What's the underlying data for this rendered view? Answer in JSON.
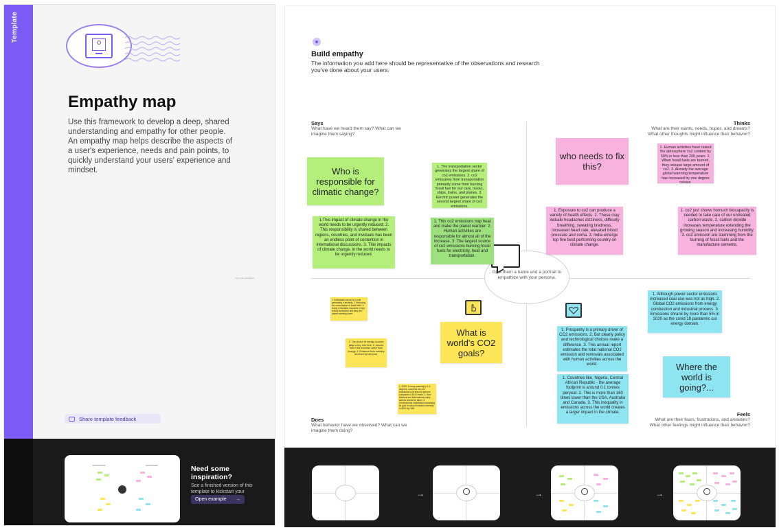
{
  "left_panel": {
    "strip_label": "Template",
    "title": "Empathy map",
    "description": "Use this framework to develop a deep, shared understanding and empathy for other people. An empathy map helps describe the aspects of a user's experience, needs and pain points, to quickly understand your users' experience and mindset.",
    "tiny_note": "Type your paragraph...",
    "feedback_label": "Share template feedback",
    "inspiration": {
      "title": "Need some inspiration?",
      "subtitle": "See a finished version of this template to kickstart your work.",
      "button_label": "Open example",
      "button_arrow": "→"
    }
  },
  "board": {
    "title": "Build empathy",
    "description": "The information you add here should be representative of the observations and research you've done about your users.",
    "center_text": "Give them a name and a portrait to empathize with your persona.",
    "quadrants": {
      "says": {
        "label": "Says",
        "sub": "What have we heard them say? What can we imagine them saying?"
      },
      "thinks": {
        "label": "Thinks",
        "sub": "What are their wants, needs, hopes, and dreams? What other thoughts might influence their behavior?"
      },
      "does": {
        "label": "Does",
        "sub": "What behavior have we observed? What can we imagine them doing?"
      },
      "feels": {
        "label": "Feels",
        "sub": "What are their fears, frustrations, and anxieties? What other feelings might influence their behavior?"
      }
    },
    "stickies": {
      "says_big": "Who is responsible for climatic change?",
      "says_1": "1. The transportation sector generates the largest share of co2 emissions. 2. co2 emissions from transportation primarily come from burning fossil fuel for our cars, trucks, ships, trains, and planes. 3. Electric power generates the second largest share of co2 emissions.",
      "says_2": "1.This impact of climate change in the world needs to be urgently reduced. 2. This responsibility is shared between regions, countries, and inviduals has been an endless point of contention in international discussions. 3. This impacts of climate change, in the world needs to be urgently reduced.",
      "says_3": "1. This co2 emissions trap heat and make the planet warmer. 2. Human activities are responsible for almost all of the increase. 3. The largest source of co2 emissions burning fossil fuels for electricity, heat and transportation.",
      "thinks_big": "who needs to fix this?",
      "thinks_1": "1. Human activities have raised the atmosphere co2 content by 50% in less than 200 years. 2. When fossil fuels are burned, they release large amount of co2. 3. Already the average global warming temperature has increased by one degree celsius.",
      "thinks_2": "1. Exposure to co2 can produce a variety of health effects. 2. These may include headaches dizziness, difficulty breathing, sweating tiredness, increased heart rate, elevated blood pressure and coma. 3. India emerge top five best performing country on climate change.",
      "thinks_3": "1. co2 just shows homuch biocapacity is needed to take care of our untreated carbon waste. 2. carbon dioxide increases temperature extending the growing season and increasing humidity. 3. co2 emission are stemming from the burning of fossil fuels and the manufacture cements.",
      "does_tiny1": "1. Individuals can act to a role generating e-lectricity. 2. Reducing the consumption of fossil fuels. 3. Using renewable resources, helps reduce emissions and keep the planet warming lower.",
      "does_tiny2": "1. The choice of energy sources plays a key role here. 2. Around half of the increase came from energy. 3. Emission from industry declined by last year.",
      "does_big": "What is world's CO2 goals?",
      "does_tiny3": "1. 2050: To keep warming to 1.5 degrees, countries set co2 emissions by at least 45 percent compared to 2010 levels. 2. New National and International policy actions should be taken. 3. Governments contribution increasing its goal to reduce emission intensity to 65% by 2030.",
      "feels_1": "1. Although power sector emissions increased coal use was not as high. 2. Global CO2 emissions from energy combustion and industrial process. 3. Emissions shrank by more than 5% in 2020 as the covid 19 pandemic cut energy domain.",
      "feels_2": "1. Prosperity is a primary driver of CO2 emissions. 2. But clearly policy and technological choices make a difference. 3. This annual report estimates the total national CO2 emission and removals associated with human activities across the world.",
      "feels_big": "Where the world is going?...",
      "feels_3": "1. Countries like, Nigeria, Central African Republic - the average footprint is around 0.1 tonnes peryear. 2. This is more than 160 times lower than the USA, Australia and Canada. 3. This inequality in emissions across the world creates a larger impact in the climate."
    }
  },
  "bottom_steps": {
    "arrow": "→"
  },
  "colors": {
    "accent": "#7c5cf6",
    "green": "#b3ef7a",
    "pink": "#f7b2de",
    "yellow": "#fce658",
    "blue": "#8fe4f2"
  }
}
